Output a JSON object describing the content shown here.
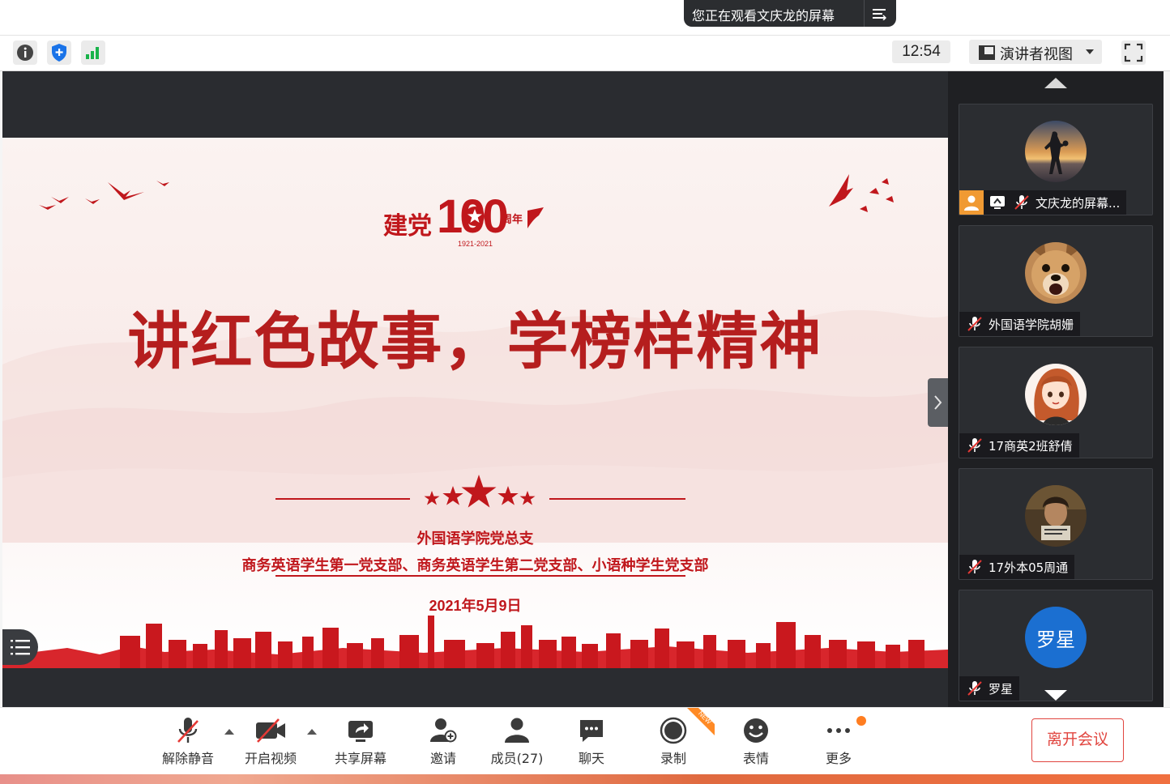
{
  "share_banner": {
    "text": "您正在观看文庆龙的屏幕",
    "menu_icon": "list-menu-icon"
  },
  "toolbar": {
    "clock": "12:54",
    "view_label": "演讲者视图",
    "icons": [
      "info-icon",
      "shield-icon",
      "signal-icon",
      "fullscreen-icon"
    ]
  },
  "slide": {
    "logo_text": "建党",
    "logo_number": "100",
    "logo_suffix": "周年",
    "logo_years": "1921-2021",
    "title": "讲红色故事，学榜样精神",
    "org_line1": "外国语学院党总支",
    "org_line2": "商务英语学生第一党支部、商务英语学生第二党支部、小语种学生党支部",
    "date": "2021年5月9日",
    "accent_color": "#c0171c"
  },
  "participants": [
    {
      "name": "文庆龙的屏幕...",
      "avatar": "silhouette-photo",
      "host": true,
      "sharing": true,
      "muted": true
    },
    {
      "name": "外国语学院胡姗",
      "avatar": "dog-photo",
      "muted": true
    },
    {
      "name": "17商英2班舒倩",
      "avatar": "anime-girl",
      "muted": true
    },
    {
      "name": "17外本05周通",
      "avatar": "movie-poster",
      "muted": true
    },
    {
      "name": "罗星",
      "avatar_text": "罗星",
      "avatar_color": "#1b6fd1",
      "muted": true
    }
  ],
  "bottom": {
    "unmute": "解除静音",
    "video": "开启视频",
    "share": "共享屏幕",
    "invite": "邀请",
    "members": "成员(27)",
    "chat": "聊天",
    "record": "录制",
    "emoji": "表情",
    "more": "更多",
    "leave": "离开会议",
    "new_badge": "NEW"
  }
}
